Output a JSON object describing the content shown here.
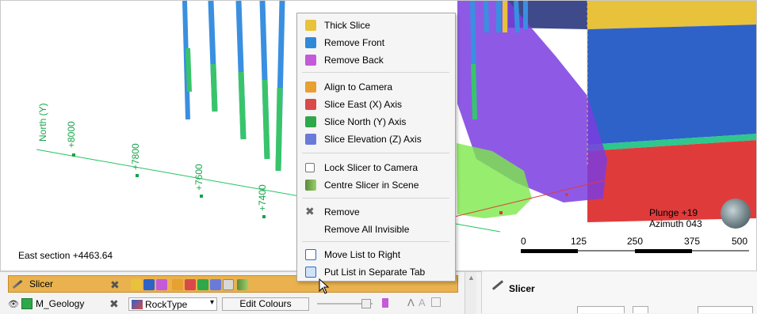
{
  "scene": {
    "axis_title": "North (Y)",
    "axis_ticks": [
      "+8000",
      "+7800",
      "+7600",
      "+7400"
    ],
    "section_label": "East section +4463.64",
    "plunge": "Plunge +19",
    "azimuth": "Azimuth 043",
    "scale_ticks": [
      "0",
      "125",
      "250",
      "375",
      "500"
    ]
  },
  "context_menu": {
    "items": [
      {
        "label": "Thick Slice",
        "icon": "thick-slice-icon"
      },
      {
        "label": "Remove Front",
        "icon": "remove-front-icon"
      },
      {
        "label": "Remove Back",
        "icon": "remove-back-icon"
      },
      {
        "label": "Align to Camera",
        "icon": "align-camera-icon"
      },
      {
        "label": "Slice East (X) Axis",
        "icon": "slice-east-icon"
      },
      {
        "label": "Slice North (Y) Axis",
        "icon": "slice-north-icon"
      },
      {
        "label": "Slice Elevation (Z) Axis",
        "icon": "slice-elevation-icon"
      },
      {
        "label": "Lock Slicer to Camera",
        "icon": "checkbox-icon"
      },
      {
        "label": "Centre Slicer in Scene",
        "icon": "centre-slicer-icon"
      },
      {
        "label": "Remove",
        "icon": "remove-icon"
      },
      {
        "label": "Remove All Invisible",
        "icon": ""
      },
      {
        "label": "Move List to Right",
        "icon": "move-list-icon"
      },
      {
        "label": "Put List in Separate Tab",
        "icon": "separate-tab-icon"
      }
    ]
  },
  "shape_list": {
    "row1_label": "Slicer",
    "row2_label": "M_Geology",
    "colour_by": "RockType",
    "edit_colours": "Edit Colours"
  },
  "properties": {
    "title": "Slicer"
  }
}
